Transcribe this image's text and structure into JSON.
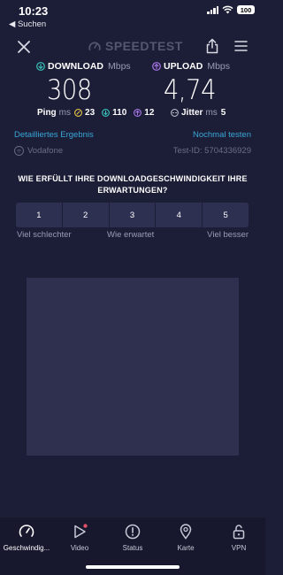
{
  "status_bar": {
    "time": "10:23",
    "back_label": "◀ Suchen",
    "battery": "100"
  },
  "header": {
    "logo_text": "SPEEDTEST",
    "icons": [
      "close-icon",
      "speedometer-logo-icon",
      "share-icon",
      "menu-icon"
    ]
  },
  "download": {
    "label": "DOWNLOAD",
    "unit": "Mbps",
    "value": "308",
    "icon": "download-arrow-icon",
    "color": "#3ac4b8"
  },
  "upload": {
    "label": "UPLOAD",
    "unit": "Mbps",
    "value": "4,74",
    "icon": "upload-arrow-icon",
    "color": "#a878e8"
  },
  "ping": {
    "label": "Ping",
    "unit": "ms",
    "idle": "23",
    "download": "110",
    "upload": "12",
    "idle_color": "#e8c64a"
  },
  "jitter": {
    "label": "Jitter",
    "unit": "ms",
    "value": "5"
  },
  "links": {
    "detailed": "Detailliertes Ergebnis",
    "retest": "Nochmal testen"
  },
  "provider": {
    "name": "Vodafone",
    "test_id": "Test-ID: 5704336929"
  },
  "survey": {
    "question": "WIE ERFÜLLT IHRE DOWNLOADGESCHWINDIGKEIT IHRE ERWARTUNGEN?",
    "options": [
      "1",
      "2",
      "3",
      "4",
      "5"
    ],
    "label_low": "Viel schlechter",
    "label_mid": "Wie erwartet",
    "label_high": "Viel besser"
  },
  "tabs": [
    {
      "label": "Geschwindig...",
      "icon": "speed-gauge-icon",
      "active": true
    },
    {
      "label": "Video",
      "icon": "play-icon",
      "active": false
    },
    {
      "label": "Status",
      "icon": "alert-icon",
      "active": false
    },
    {
      "label": "Karte",
      "icon": "map-pin-icon",
      "active": false
    },
    {
      "label": "VPN",
      "icon": "lock-icon",
      "active": false
    }
  ],
  "colors": {
    "background": "#1c1d37",
    "accent_link": "#39a7d6",
    "tab_badge": "#e0506a"
  }
}
